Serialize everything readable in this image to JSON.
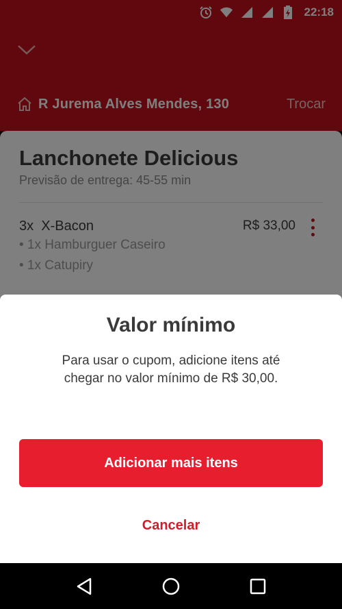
{
  "status_bar": {
    "time": "22:18",
    "icons": [
      "alarm-icon",
      "wifi-icon",
      "signal-icon",
      "signal-icon",
      "battery-icon"
    ]
  },
  "header": {
    "collapse_icon": "chevron-down-icon",
    "address": "R Jurema Alves Mendes, 130",
    "change_label": "Trocar",
    "brand_color": "#c0101a"
  },
  "cart": {
    "store_name": "Lanchonete Delicious",
    "delivery_estimate": "Previsão de entrega: 45-55 min",
    "items": [
      {
        "title": "3x  X-Bacon",
        "price": "R$ 33,00",
        "options": [
          "• 1x Hamburguer Caseiro",
          "• 1x Catupiry"
        ]
      }
    ]
  },
  "dialog": {
    "title": "Valor mínimo",
    "message": "Para usar o cupom, adicione itens até chegar no valor mínimo de R$ 30,00.",
    "primary_label": "Adicionar mais itens",
    "secondary_label": "Cancelar",
    "accent_color": "#e61e2e"
  },
  "nav_bar": {
    "icons": [
      "back-icon",
      "home-icon",
      "recents-icon"
    ]
  }
}
